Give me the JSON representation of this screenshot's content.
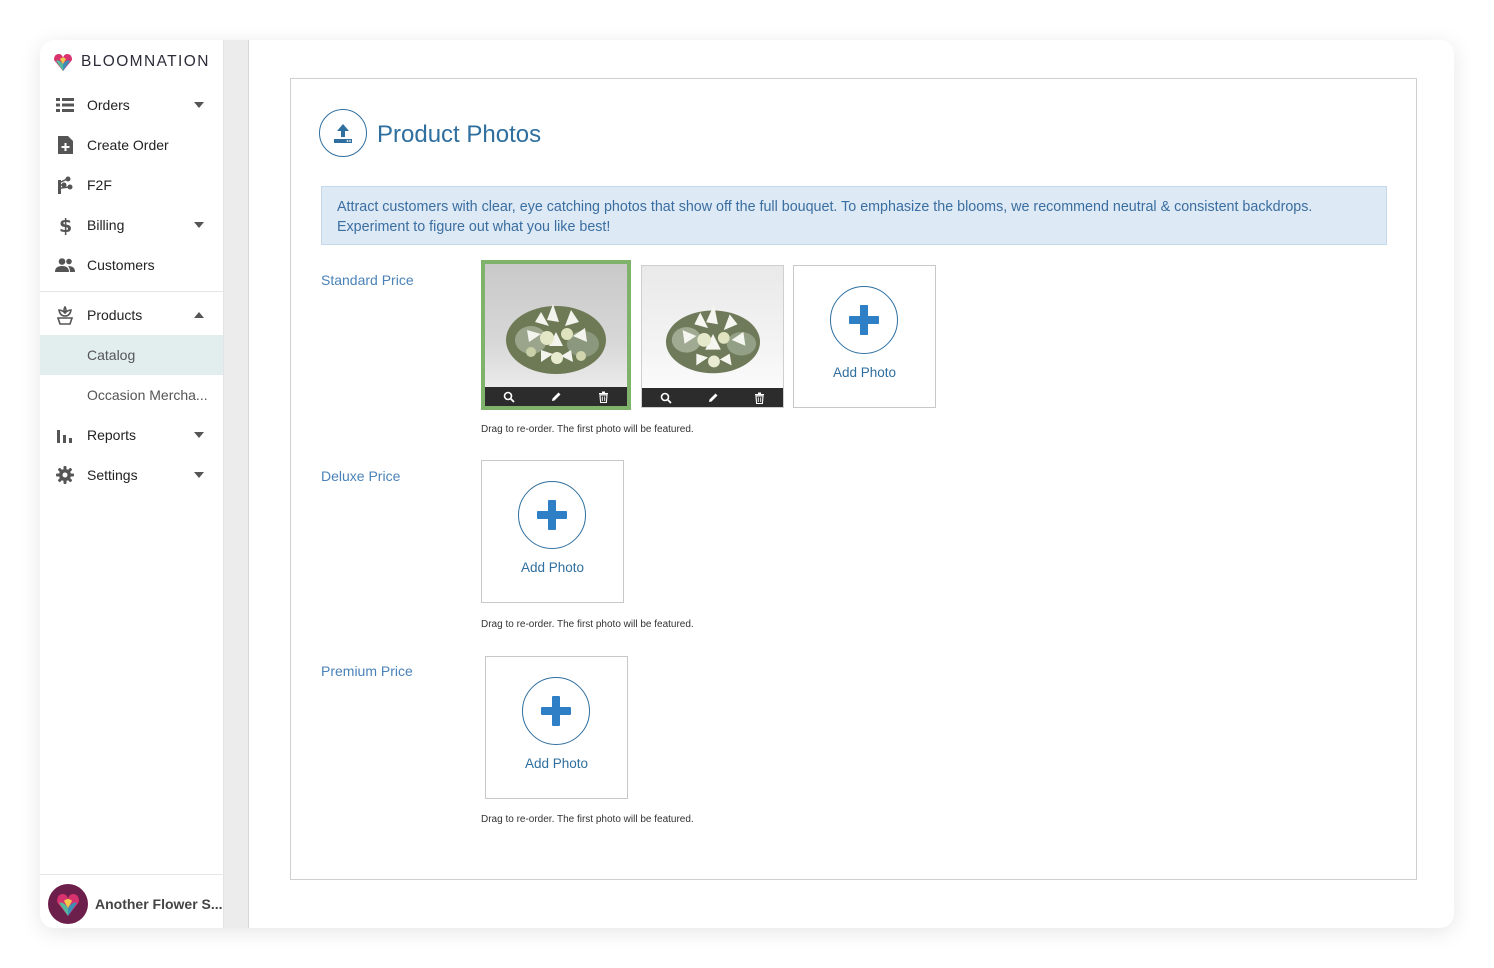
{
  "brand": {
    "name": "BLOOMNATION"
  },
  "sidebar": {
    "items": [
      {
        "label": "Orders",
        "icon": "list-icon",
        "expandable": true
      },
      {
        "label": "Create Order",
        "icon": "document-plus-icon",
        "expandable": false
      },
      {
        "label": "F2F",
        "icon": "flower-network-icon",
        "expandable": false
      },
      {
        "label": "Billing",
        "icon": "dollar-icon",
        "expandable": true
      },
      {
        "label": "Customers",
        "icon": "people-icon",
        "expandable": false
      },
      {
        "label": "Products",
        "icon": "flower-pot-icon",
        "expandable": true,
        "expanded": true
      },
      {
        "label": "Reports",
        "icon": "bar-chart-icon",
        "expandable": true
      },
      {
        "label": "Settings",
        "icon": "gear-icon",
        "expandable": true
      }
    ],
    "products_sub": [
      {
        "label": "Catalog",
        "active": true
      },
      {
        "label": "Occasion Mercha..."
      }
    ],
    "account": {
      "name": "Another Flower S..."
    }
  },
  "panel": {
    "title": "Product Photos",
    "icon": "upload-icon",
    "info": "Attract customers with clear, eye catching photos that show off the full bouquet. To emphasize the blooms, we recommend neutral & consistent backdrops. Experiment to figure out what you like best!",
    "sections": [
      {
        "label": "Standard Price",
        "photos": 2,
        "add_label": "Add Photo",
        "hint": "Drag to re-order. The first photo will be featured."
      },
      {
        "label": "Deluxe Price",
        "photos": 0,
        "add_label": "Add Photo",
        "hint": "Drag to re-order. The first photo will be featured."
      },
      {
        "label": "Premium Price",
        "photos": 0,
        "add_label": "Add Photo",
        "hint": "Drag to re-order. The first photo will be featured."
      }
    ]
  },
  "colors": {
    "accent": "#2f6f9f",
    "info_bg": "#dde9f4",
    "featured_border": "#7fb26a",
    "active_nav_bg": "#e2eeee"
  }
}
